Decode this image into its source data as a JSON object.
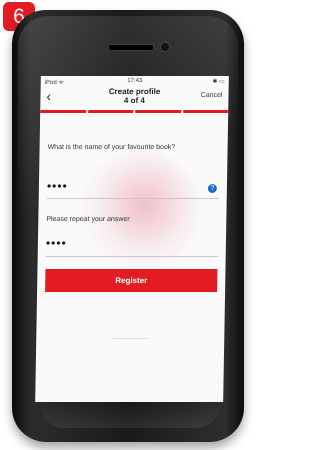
{
  "badge": {
    "number": "6"
  },
  "status": {
    "left": "iPod ᯤ",
    "time": "17:43",
    "right": "✱ ▭"
  },
  "header": {
    "back_icon": "‹",
    "title_line1": "Create profile",
    "title_line2": "4 of 4",
    "cancel": "Cancel"
  },
  "progress": {
    "steps_total": 4,
    "steps_complete": 4
  },
  "form": {
    "question": "What is the name of your favourite book?",
    "answer_masked": "••••",
    "help_icon": "?",
    "repeat_label": "Please repeat your answer",
    "repeat_masked": "••••",
    "register_label": "Register"
  },
  "colors": {
    "accent": "#e31b23",
    "help_blue": "#1f6ad1"
  }
}
